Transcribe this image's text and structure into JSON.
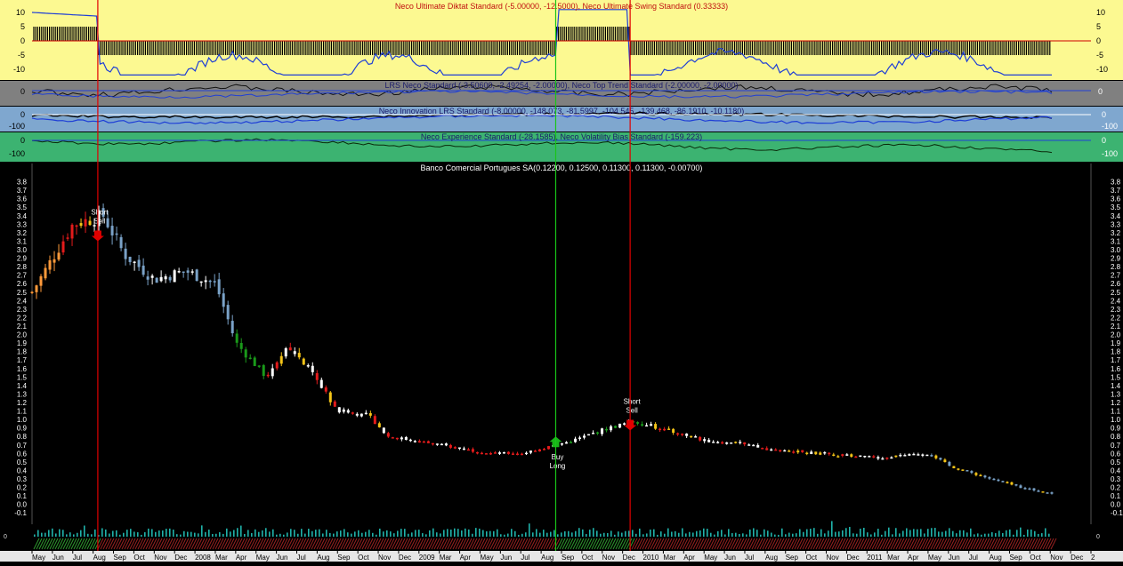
{
  "colors": {
    "panel1_bg": "#fcf991",
    "panel2_bg": "#808080",
    "panel3_bg": "#7fa7cf",
    "panel4_bg": "#3cb371",
    "main_bg": "#000000",
    "up_candle": "#ffffff",
    "down_candle": "#7aa2c8",
    "red_candle": "#e31b1b",
    "yellow_candle": "#f5c518",
    "green_candle": "#1a9a1a",
    "orange_candle": "#ff9a3a",
    "sell_line": "#e00000",
    "buy_line": "#19c519"
  },
  "panels": [
    {
      "title": "Neco Ultimate Diktat Standard (-5.00000, -12.5000), Neco Ultimate Swing Standard (0.33333)",
      "ticks": [
        "10",
        "5",
        "0",
        "-5",
        "-10"
      ]
    },
    {
      "title": "LRS Neco Standard (-3.50600, -2.49254, -2.00000), Neco Top Trend Standard (-2.00000, -2.00000)",
      "ticks": [
        "0"
      ]
    },
    {
      "title": "Neco Innovation LRS Standard (-8.00000, -148.073, -81.5997, -104.545, -139.468, -86.1910, -10.1180)",
      "ticks": [
        "0",
        "-100"
      ]
    },
    {
      "title": "Neco Experience Standard (-28.1585), Neco Volatility Bias Standard (-159.223)",
      "ticks": [
        "0",
        "-100"
      ]
    }
  ],
  "chart_data": {
    "type": "candlestick",
    "title": "Banco Comercial Portugues SA(0.12200, 0.12500, 0.11300, 0.11300, -0.00700)",
    "ylim": [
      -0.15,
      3.9
    ],
    "y_ticks": [
      "3.8",
      "3.7",
      "3.6",
      "3.5",
      "3.4",
      "3.3",
      "3.2",
      "3.1",
      "3.0",
      "2.9",
      "2.8",
      "2.7",
      "2.6",
      "2.5",
      "2.4",
      "2.3",
      "2.2",
      "2.1",
      "2.0",
      "1.9",
      "1.8",
      "1.7",
      "1.6",
      "1.5",
      "1.4",
      "1.3",
      "1.2",
      "1.1",
      "1.0",
      "0.9",
      "0.8",
      "0.7",
      "0.6",
      "0.5",
      "0.4",
      "0.3",
      "0.2",
      "0.1",
      "0.0",
      "-0.1"
    ],
    "x_labels": [
      "May",
      "Jun",
      "Jul",
      "Aug",
      "Sep",
      "Oct",
      "Nov",
      "Dec",
      "2008",
      "Mar",
      "Apr",
      "May",
      "Jun",
      "Jul",
      "Aug",
      "Sep",
      "Oct",
      "Nov",
      "Dec",
      "2009",
      "Mar",
      "Apr",
      "May",
      "Jun",
      "Jul",
      "Aug",
      "Sep",
      "Oct",
      "Nov",
      "Dec",
      "2010",
      "Mar",
      "Apr",
      "May",
      "Jun",
      "Jul",
      "Aug",
      "Sep",
      "Oct",
      "Nov",
      "Dec",
      "2011",
      "Mar",
      "Apr",
      "May",
      "Jun",
      "Jul",
      "Aug",
      "Sep",
      "Oct",
      "Nov",
      "Dec",
      "2"
    ],
    "price_path": [
      [
        0.0,
        2.5
      ],
      [
        0.04,
        3.3
      ],
      [
        0.07,
        3.4
      ],
      [
        0.09,
        2.95
      ],
      [
        0.12,
        2.65
      ],
      [
        0.15,
        2.75
      ],
      [
        0.18,
        2.6
      ],
      [
        0.2,
        1.9
      ],
      [
        0.23,
        1.5
      ],
      [
        0.25,
        1.9
      ],
      [
        0.28,
        1.45
      ],
      [
        0.3,
        1.1
      ],
      [
        0.33,
        1.05
      ],
      [
        0.35,
        0.8
      ],
      [
        0.4,
        0.7
      ],
      [
        0.45,
        0.6
      ],
      [
        0.48,
        0.6
      ],
      [
        0.53,
        0.75
      ],
      [
        0.56,
        0.88
      ],
      [
        0.59,
        0.98
      ],
      [
        0.62,
        0.88
      ],
      [
        0.66,
        0.75
      ],
      [
        0.69,
        0.72
      ],
      [
        0.72,
        0.65
      ],
      [
        0.77,
        0.6
      ],
      [
        0.83,
        0.55
      ],
      [
        0.88,
        0.6
      ],
      [
        0.9,
        0.45
      ],
      [
        0.94,
        0.3
      ],
      [
        0.97,
        0.2
      ],
      [
        1.0,
        0.13
      ]
    ],
    "signals": [
      {
        "label": "Short Sell",
        "direction": "sell",
        "x": 0.0645,
        "price": 3.1
      },
      {
        "label": "Buy Long",
        "direction": "buy",
        "x": 0.5135,
        "price": 0.8
      },
      {
        "label": "Short Sell",
        "direction": "sell",
        "x": 0.5865,
        "price": 0.87
      }
    ]
  },
  "volume": {
    "left_tick": "0",
    "right_tick": "0"
  }
}
